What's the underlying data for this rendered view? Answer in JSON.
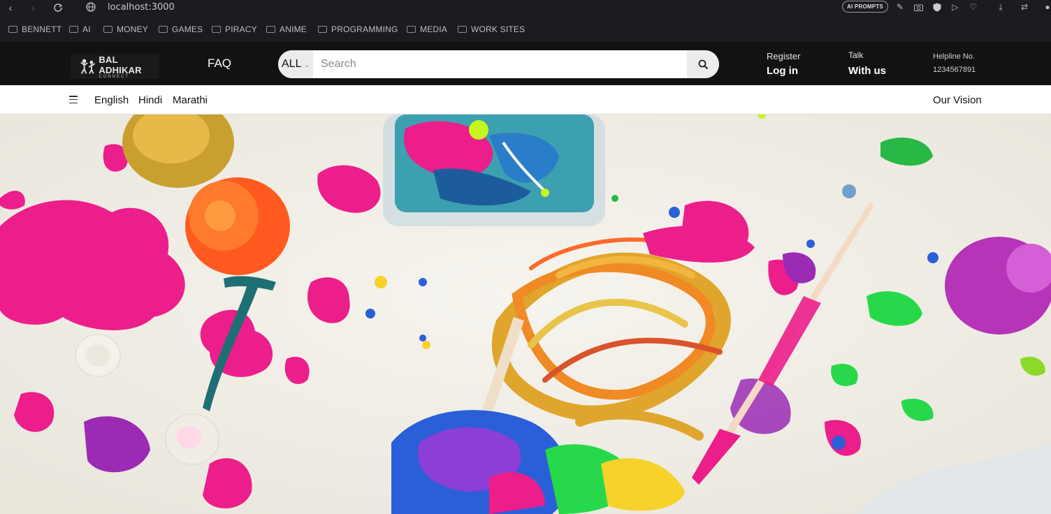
{
  "browser": {
    "url": "localhost:3000",
    "ai_prompts_label": "AI PROMPTS",
    "icons": [
      "back-icon",
      "forward-icon",
      "reload-icon",
      "site-info-icon",
      "edit-icon",
      "camera-icon",
      "shield-icon",
      "send-icon",
      "heart-icon",
      "download-icon",
      "sliders-icon",
      "profile-icon"
    ]
  },
  "bookmarks": [
    {
      "label": "BENNETT"
    },
    {
      "label": "AI"
    },
    {
      "label": "MONEY"
    },
    {
      "label": "GAMES"
    },
    {
      "label": "PIRACY"
    },
    {
      "label": "ANIME"
    },
    {
      "label": "PROGRAMMING"
    },
    {
      "label": "MEDIA"
    },
    {
      "label": "WORK SITES"
    }
  ],
  "header": {
    "logo_text": "BAL ADHIKAR",
    "logo_sub": "CONNECT",
    "faq": "FAQ",
    "search": {
      "category": "ALL",
      "placeholder": "Search"
    },
    "register": "Register",
    "login": "Log in",
    "talk": "Talk",
    "with_us": "With us",
    "helpline_label": "Helpline No.",
    "helpline_number": "1234567891"
  },
  "subnav": {
    "languages": [
      "English",
      "Hindi",
      "Marathi"
    ],
    "vision": "Our Vision"
  },
  "colors": {
    "header_bg": "#121212",
    "chrome_bg": "#1c1b1f",
    "paper": "#f1eee6",
    "magenta": "#ec1e8c",
    "orange": "#ff5a1f",
    "gold": "#e0a52c",
    "green": "#27d94a",
    "purple": "#9b2bb5"
  }
}
